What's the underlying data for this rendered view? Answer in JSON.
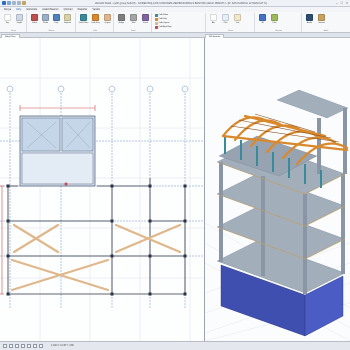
{
  "app": {
    "title": "ideCAD Statik - (with group build 8) - GÖRENTAŞ-ÇOK KORUNMA ZEMİNİ/KORDA 9 BANYANI ÇELİK PRESTİJ - [D: KAT-KAPAKLI 12 DEN KAT S]"
  },
  "menu": [
    "Dosya",
    "Giriş",
    "Görüntüle",
    "Analiz/Tasarım",
    "Çizimler",
    "Raporlar",
    "Yardım"
  ],
  "menu_active": 1,
  "ribbon": {
    "groups": [
      {
        "name": "Seçim",
        "buttons": [
          "Seç",
          "Kaydır"
        ]
      },
      {
        "name": "Eleman",
        "buttons": [
          "Kolon",
          "Perde",
          "Kiriş",
          "Döşeme"
        ]
      },
      {
        "name": "Çelik",
        "buttons": [
          "Çelik Kolon",
          "Çelik Kiriş",
          "Çapraz"
        ]
      },
      {
        "name": "Temel",
        "buttons": [
          "Radye",
          "Tekil",
          "Kazık"
        ]
      },
      {
        "name": "Düzen",
        "buttons": [
          "Aks",
          "Ölçü",
          "Yazı"
        ]
      },
      {
        "name": "Görünüm",
        "buttons": [
          "3B",
          "Plan"
        ]
      },
      {
        "name": "Analiz",
        "buttons": [
          "Analiz",
          "Tasarım"
        ]
      }
    ],
    "small_items": [
      "Çelik Kolon",
      "Çelik Kiriş",
      "Çelik Çapraz",
      "Çelik Aşık Kirişi"
    ]
  },
  "tabs": {
    "left": "Kalıp Planı",
    "right": "3B Görüntü"
  },
  "status": {
    "text": "1:100  X: 12.35  Y: 4.80"
  },
  "colors": {
    "ribbon_bg": "#f7f8fa",
    "steel_orange": "#d9892b",
    "steel_teal": "#3a8b9a",
    "concrete": "#9aa6b4",
    "basement_blue": "#3f4fb0",
    "brace": "#e0b78a",
    "grid_blue": "#6d8fc8",
    "grid_red": "#d04a4a"
  },
  "icons": [
    "save-icon",
    "undo-icon",
    "redo-icon",
    "print-icon",
    "minimize-icon",
    "maximize-icon",
    "close-icon"
  ]
}
